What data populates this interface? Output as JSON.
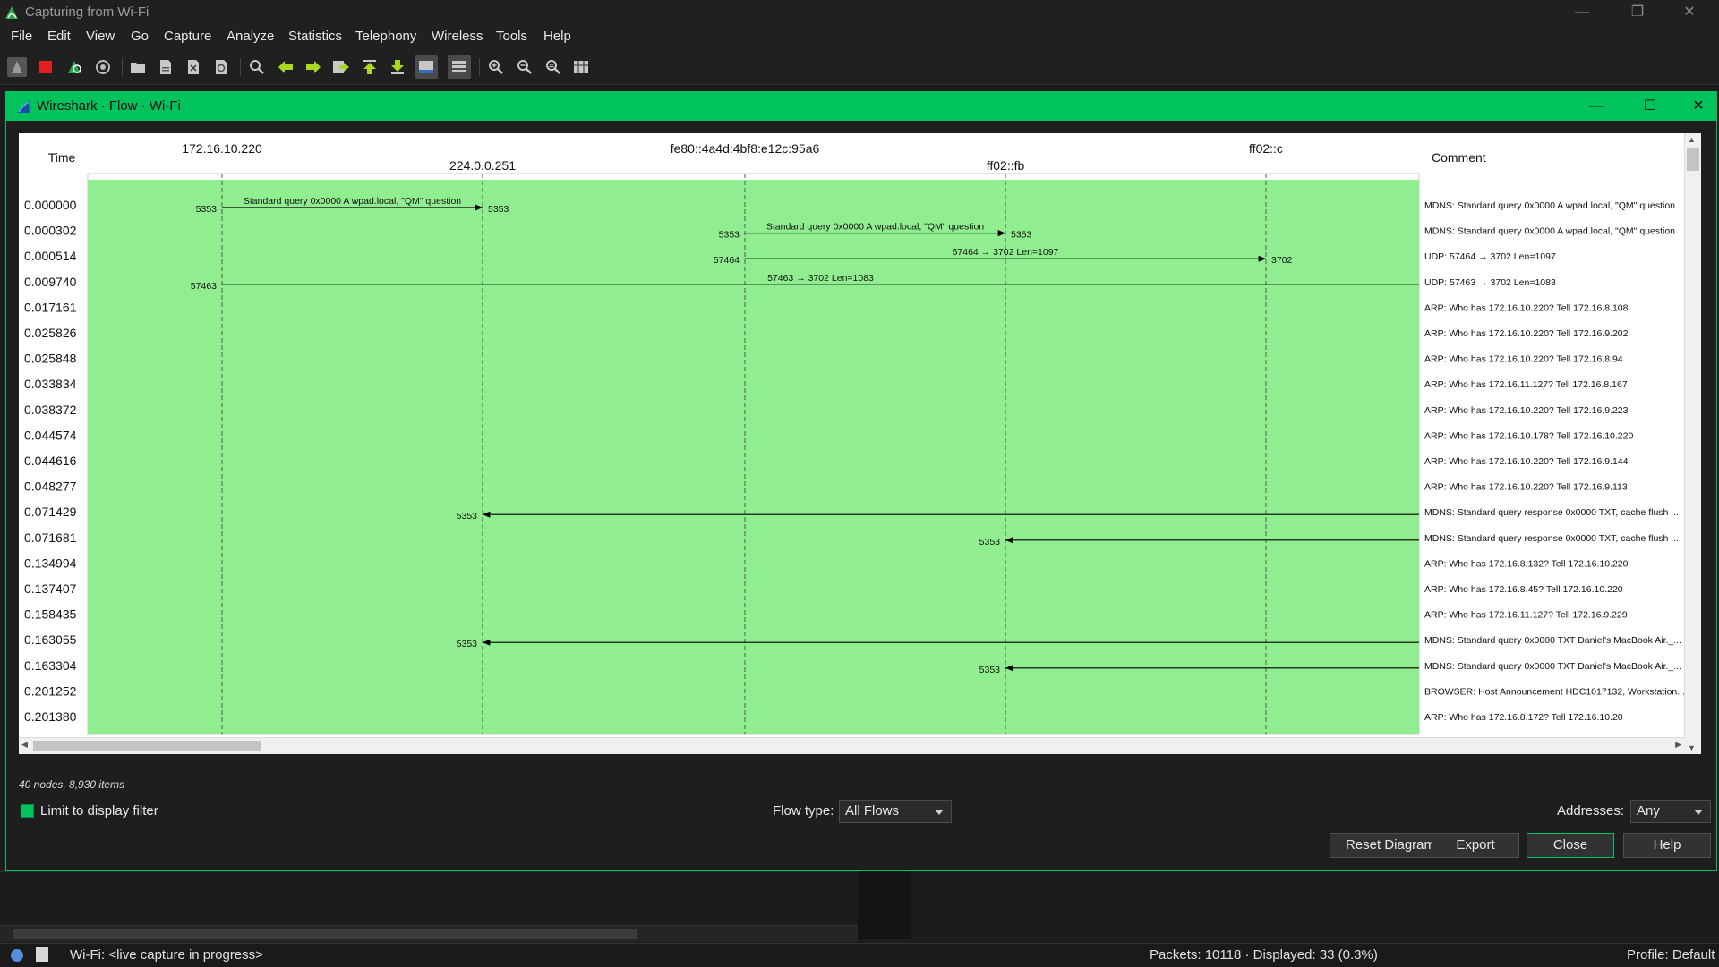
{
  "window": {
    "title": "Capturing from Wi-Fi"
  },
  "menu": [
    "File",
    "Edit",
    "View",
    "Go",
    "Capture",
    "Analyze",
    "Statistics",
    "Telephony",
    "Wireless",
    "Tools",
    "Help"
  ],
  "toolbar": {
    "buttons": [
      "start-capture-icon",
      "stop-capture-icon",
      "restart-capture-icon",
      "capture-options-icon",
      "open-file-icon",
      "save-file-icon",
      "close-file-icon",
      "reload-file-icon",
      "find-packet-icon",
      "go-back-icon",
      "go-forward-icon",
      "go-to-packet-icon",
      "go-first-icon",
      "go-last-icon",
      "autoscroll-icon",
      "colorize-icon",
      "zoom-in-icon",
      "zoom-out-icon",
      "normal-size-icon",
      "resize-columns-icon"
    ]
  },
  "dialog": {
    "title": "Wireshark · Flow · Wi-Fi",
    "columns": {
      "time": "Time",
      "comment": "Comment"
    },
    "nodes": [
      "172.16.10.220",
      "224.0.0.251",
      "fe80::4a4d:4bf8:e12c:95a6",
      "ff02::fb",
      "ff02::c"
    ],
    "rows": [
      {
        "time": "0.000000",
        "comment": "MDNS: Standard query 0x0000 A wpad.local, \"QM\" question"
      },
      {
        "time": "0.000302",
        "comment": "MDNS: Standard query 0x0000 A wpad.local, \"QM\" question"
      },
      {
        "time": "0.000514",
        "comment": "UDP: 57464 → 3702 Len=1097"
      },
      {
        "time": "0.009740",
        "comment": "UDP: 57463 → 3702 Len=1083"
      },
      {
        "time": "0.017161",
        "comment": "ARP: Who has 172.16.10.220? Tell 172.16.8.108"
      },
      {
        "time": "0.025826",
        "comment": "ARP: Who has 172.16.10.220? Tell 172.16.9.202"
      },
      {
        "time": "0.025848",
        "comment": "ARP: Who has 172.16.10.220? Tell 172.16.8.94"
      },
      {
        "time": "0.033834",
        "comment": "ARP: Who has 172.16.11.127? Tell 172.16.8.167"
      },
      {
        "time": "0.038372",
        "comment": "ARP: Who has 172.16.10.220? Tell 172.16.9.223"
      },
      {
        "time": "0.044574",
        "comment": "ARP: Who has 172.16.10.178? Tell 172.16.10.220"
      },
      {
        "time": "0.044616",
        "comment": "ARP: Who has 172.16.10.220? Tell 172.16.9.144"
      },
      {
        "time": "0.048277",
        "comment": "ARP: Who has 172.16.10.220? Tell 172.16.9.113"
      },
      {
        "time": "0.071429",
        "comment": "MDNS: Standard query response 0x0000 TXT, cache flush ..."
      },
      {
        "time": "0.071681",
        "comment": "MDNS: Standard query response 0x0000 TXT, cache flush ..."
      },
      {
        "time": "0.134994",
        "comment": "ARP: Who has 172.16.8.132? Tell 172.16.10.220"
      },
      {
        "time": "0.137407",
        "comment": "ARP: Who has 172.16.8.45? Tell 172.16.10.220"
      },
      {
        "time": "0.158435",
        "comment": "ARP: Who has 172.16.11.127? Tell 172.16.9.229"
      },
      {
        "time": "0.163055",
        "comment": "MDNS: Standard query 0x0000 TXT Daniel's MacBook Air._..."
      },
      {
        "time": "0.163304",
        "comment": "MDNS: Standard query 0x0000 TXT Daniel's MacBook Air._..."
      },
      {
        "time": "0.201252",
        "comment": "BROWSER: Host Announcement HDC1017132, Workstation..."
      },
      {
        "time": "0.201380",
        "comment": "ARP: Who has 172.16.8.172? Tell 172.16.10.20"
      }
    ],
    "arrows": [
      {
        "row": 0,
        "from": 0,
        "to": 1,
        "src_port": "5353",
        "dst_port": "5353",
        "label": "Standard query 0x0000 A wpad.local, \"QM\" question"
      },
      {
        "row": 1,
        "from": 2,
        "to": 3,
        "src_port": "5353",
        "dst_port": "5353",
        "label": "Standard query 0x0000 A wpad.local, \"QM\" question"
      },
      {
        "row": 2,
        "from": 2,
        "to": 4,
        "src_port": "57464",
        "dst_port": "3702",
        "label": "57464 → 3702 Len=1097"
      },
      {
        "row": 3,
        "from": 0,
        "to": "offscreen",
        "src_port": "57463",
        "dst_port": "",
        "label": "57463 → 3702 Len=1083"
      },
      {
        "row": 12,
        "from": "offscreen",
        "to": 1,
        "src_port": "",
        "dst_port": "5353",
        "label": ""
      },
      {
        "row": 13,
        "from": "offscreen",
        "to": 3,
        "src_port": "",
        "dst_port": "5353",
        "label": ""
      },
      {
        "row": 17,
        "from": "offscreen",
        "to": 1,
        "src_port": "",
        "dst_port": "5353",
        "label": ""
      },
      {
        "row": 18,
        "from": "offscreen",
        "to": 3,
        "src_port": "",
        "dst_port": "5353",
        "label": ""
      }
    ],
    "status_info": "40 nodes, 8,930 items",
    "limit_filter_label": "Limit to display filter",
    "limit_filter_checked": true,
    "flow_type_label": "Flow type:",
    "flow_type_value": "All Flows",
    "addresses_label": "Addresses:",
    "addresses_value": "Any",
    "buttons": {
      "reset": "Reset Diagram",
      "export": "Export",
      "close": "Close",
      "help": "Help"
    }
  },
  "statusbar": {
    "capture": "Wi-Fi: <live capture in progress>",
    "packets": "Packets: 10118 · Displayed: 33 (0.3%)",
    "profile": "Profile: Default"
  },
  "colors": {
    "accent": "#00c35e",
    "flow_bg": "#90ee90",
    "dialog_title": "#00c35e"
  }
}
